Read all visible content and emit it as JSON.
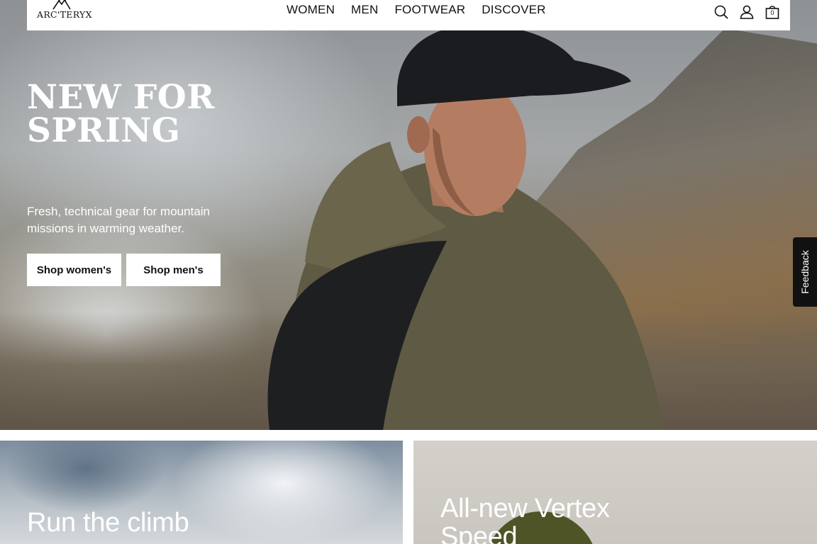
{
  "brand": {
    "logo_text": "ARC'TERYX"
  },
  "nav": {
    "items": [
      "WOMEN",
      "MEN",
      "FOOTWEAR",
      "DISCOVER"
    ]
  },
  "header_icons": {
    "search": "search-icon",
    "account": "user-icon",
    "cart": "bag-icon",
    "cart_count": "0"
  },
  "hero": {
    "title": "NEW FOR SPRING",
    "subtitle": "Fresh, technical gear for mountain missions in warming weather.",
    "buttons": {
      "women": "Shop women's",
      "men": "Shop men's"
    }
  },
  "feedback": {
    "label": "Feedback"
  },
  "tiles": [
    {
      "title": "Run the climb"
    },
    {
      "title": "All-new Vertex Speed"
    }
  ]
}
